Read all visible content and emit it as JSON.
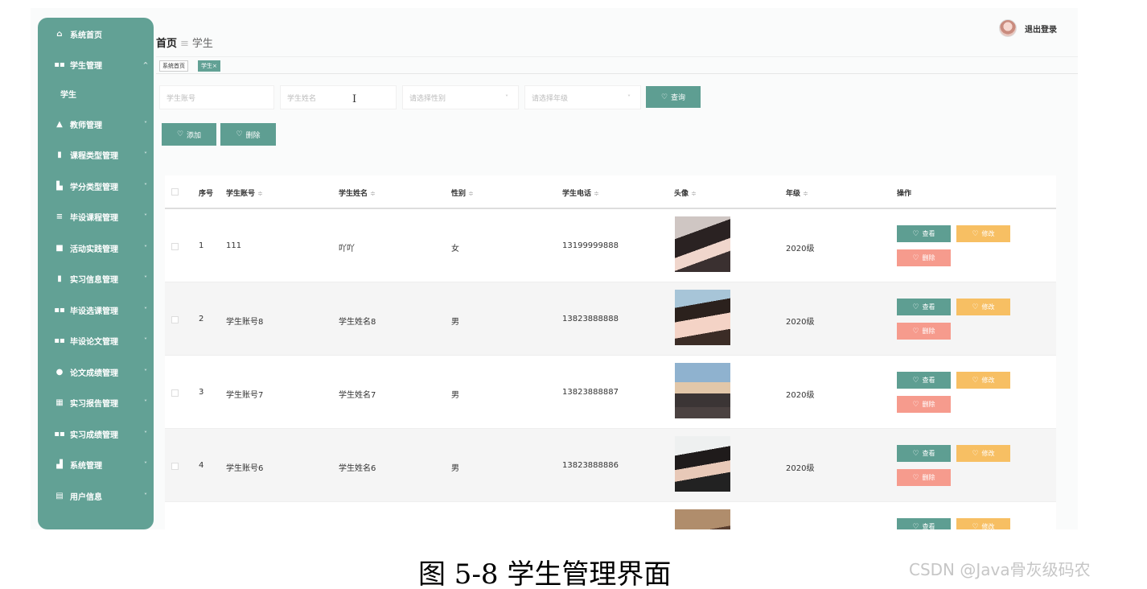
{
  "sidebar": {
    "items": [
      {
        "icon": "home-icon",
        "glyph": "⌂",
        "label": "系统首页",
        "chevron": ""
      },
      {
        "icon": "grid-icon",
        "glyph": "▪▪",
        "label": "学生管理",
        "chevron": "^"
      },
      {
        "icon": "teacher-icon",
        "glyph": "▲",
        "label": "教师管理",
        "chevron": "˅"
      },
      {
        "icon": "clipboard-icon",
        "glyph": "▮",
        "label": "课程类型管理",
        "chevron": "˅"
      },
      {
        "icon": "chart-icon",
        "glyph": "▙",
        "label": "学分类型管理",
        "chevron": "˅"
      },
      {
        "icon": "list-icon",
        "glyph": "≡",
        "label": "毕设课程管理",
        "chevron": "˅"
      },
      {
        "icon": "printer-icon",
        "glyph": "■",
        "label": "活动实践管理",
        "chevron": "˅"
      },
      {
        "icon": "clipboard-icon",
        "glyph": "▮",
        "label": "实习信息管理",
        "chevron": "˅"
      },
      {
        "icon": "grid-icon",
        "glyph": "▪▪",
        "label": "毕设选课管理",
        "chevron": "˅"
      },
      {
        "icon": "grid-icon",
        "glyph": "▪▪",
        "label": "毕设论文管理",
        "chevron": "˅"
      },
      {
        "icon": "location-icon",
        "glyph": "●",
        "label": "论文成绩管理",
        "chevron": "˅"
      },
      {
        "icon": "table-icon",
        "glyph": "▦",
        "label": "实习报告管理",
        "chevron": "˅"
      },
      {
        "icon": "grid-icon",
        "glyph": "▪▪",
        "label": "实习成绩管理",
        "chevron": "˅"
      },
      {
        "icon": "bar-chart-icon",
        "glyph": "▟",
        "label": "系统管理",
        "chevron": "˅"
      },
      {
        "icon": "card-icon",
        "glyph": "▤",
        "label": "用户信息",
        "chevron": "˅"
      }
    ],
    "sub_item": "学生"
  },
  "header": {
    "breadcrumb_home": "首页",
    "breadcrumb_sep": "≡",
    "breadcrumb_current": "学生",
    "logout": "退出登录"
  },
  "tabs": [
    {
      "label": "系统首页"
    },
    {
      "label": "学生×"
    }
  ],
  "search": {
    "account_placeholder": "学生账号",
    "name_placeholder": "学生姓名",
    "gender_placeholder": "请选择性别",
    "grade_placeholder": "请选择年级",
    "search_button": "查询"
  },
  "actions": {
    "add": "添加",
    "delete": "删除"
  },
  "table": {
    "headers": {
      "index": "序号",
      "account": "学生账号",
      "name": "学生姓名",
      "gender": "性别",
      "phone": "学生电话",
      "avatar": "头像",
      "grade": "年级",
      "ops": "操作"
    },
    "sort_glyph": "≑",
    "row_buttons": {
      "view": "查看",
      "edit": "修改",
      "delete": "删除"
    },
    "rows": [
      {
        "index": "1",
        "account": "111",
        "name": "吖吖",
        "gender": "女",
        "phone": "13199999888",
        "grade": "2020级"
      },
      {
        "index": "2",
        "account": "学生账号8",
        "name": "学生姓名8",
        "gender": "男",
        "phone": "13823888888",
        "grade": "2020级"
      },
      {
        "index": "3",
        "account": "学生账号7",
        "name": "学生姓名7",
        "gender": "男",
        "phone": "13823888887",
        "grade": "2020级"
      },
      {
        "index": "4",
        "account": "学生账号6",
        "name": "学生姓名6",
        "gender": "男",
        "phone": "13823888886",
        "grade": "2020级"
      }
    ]
  },
  "caption": "图 5-8 学生管理界面",
  "watermark": "CSDN @Java骨灰级码农",
  "colors": {
    "primary": "#62a195",
    "warning": "#f7bf63",
    "danger": "#f69b8d"
  }
}
